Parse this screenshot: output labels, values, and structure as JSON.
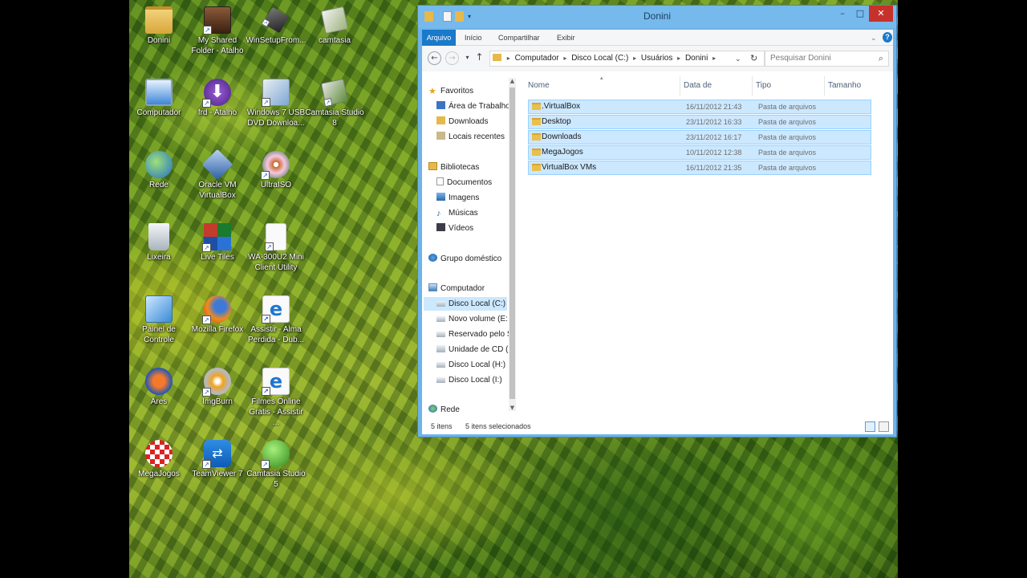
{
  "desktop": {
    "icons": [
      {
        "label": "Donini",
        "icon": "folder-icon"
      },
      {
        "label": "My Shared Folder - Atalho",
        "icon": "shortcut-icon"
      },
      {
        "label": "WinSetupFrom...",
        "icon": "usb-icon"
      },
      {
        "label": "camtasia",
        "icon": "camtasia-icon"
      },
      {
        "label": "Computador",
        "icon": "computer-icon"
      },
      {
        "label": "frd - Atalho",
        "icon": "download-icon"
      },
      {
        "label": "Windows 7 USB DVD Downloa...",
        "icon": "installer-icon"
      },
      {
        "label": "Camtasia Studio 8",
        "icon": "camtasia-icon"
      },
      {
        "label": "Rede",
        "icon": "network-icon"
      },
      {
        "label": "Oracle VM VirtualBox",
        "icon": "virtualbox-icon"
      },
      {
        "label": "UltraISO",
        "icon": "disc-icon"
      },
      {
        "label": "Lixeira",
        "icon": "recycle-bin-icon"
      },
      {
        "label": "Live Tiles",
        "icon": "tiles-icon"
      },
      {
        "label": "WA-300U2 Mini Client Utility",
        "icon": "document-icon"
      },
      {
        "label": "Painel de Controle",
        "icon": "control-panel-icon"
      },
      {
        "label": "Mozilla Firefox",
        "icon": "firefox-icon"
      },
      {
        "label": "Assistir - Alma Perdida - Dub...",
        "icon": "ie-icon"
      },
      {
        "label": "Ares",
        "icon": "ares-icon"
      },
      {
        "label": "ImgBurn",
        "icon": "imgburn-icon"
      },
      {
        "label": "Filmes Online Gratis - Assistir ...",
        "icon": "ie-icon"
      },
      {
        "label": "MegaJogos",
        "icon": "megajogos-icon"
      },
      {
        "label": "TeamViewer 7",
        "icon": "teamviewer-icon"
      },
      {
        "label": "Camtasia Studio 5",
        "icon": "camtasia-icon"
      }
    ]
  },
  "explorer": {
    "title": "Donini",
    "window_buttons": {
      "minimize": "–",
      "maximize": "□",
      "close": "✕"
    },
    "ribbon_tabs": [
      "Arquivo",
      "Início",
      "Compartilhar",
      "Exibir"
    ],
    "address": {
      "parts": [
        "Computador",
        "Disco Local (C:)",
        "Usuários",
        "Donini"
      ],
      "separator": "▸"
    },
    "search_placeholder": "Pesquisar Donini",
    "nav": {
      "favorites_header": "Favoritos",
      "favorites": [
        "Área de Trabalho",
        "Downloads",
        "Locais recentes"
      ],
      "libraries_header": "Bibliotecas",
      "libraries": [
        "Documentos",
        "Imagens",
        "Músicas",
        "Vídeos"
      ],
      "homegroup": "Grupo doméstico",
      "computer_header": "Computador",
      "drives": [
        "Disco Local (C:)",
        "Novo volume (E:",
        "Reservado pelo S",
        "Unidade de CD (",
        "Disco Local (H:)",
        "Disco Local (I:)"
      ],
      "network": "Rede"
    },
    "columns": [
      "Nome",
      "Data de modificaç...",
      "Tipo",
      "Tamanho"
    ],
    "files": [
      {
        "name": ".VirtualBox",
        "date": "16/11/2012 21:43",
        "type": "Pasta de arquivos"
      },
      {
        "name": "Desktop",
        "date": "23/11/2012 16:33",
        "type": "Pasta de arquivos"
      },
      {
        "name": "Downloads",
        "date": "23/11/2012 16:17",
        "type": "Pasta de arquivos"
      },
      {
        "name": "MegaJogos",
        "date": "10/11/2012 12:38",
        "type": "Pasta de arquivos"
      },
      {
        "name": "VirtualBox VMs",
        "date": "16/11/2012 21:35",
        "type": "Pasta de arquivos"
      }
    ],
    "status": {
      "count": "5 itens",
      "selected": "5 itens selecionados"
    },
    "colors": {
      "title_bar": "#76b9ec",
      "accent": "#1979ca",
      "selection": "#cce8ff",
      "close": "#c7312c"
    }
  }
}
